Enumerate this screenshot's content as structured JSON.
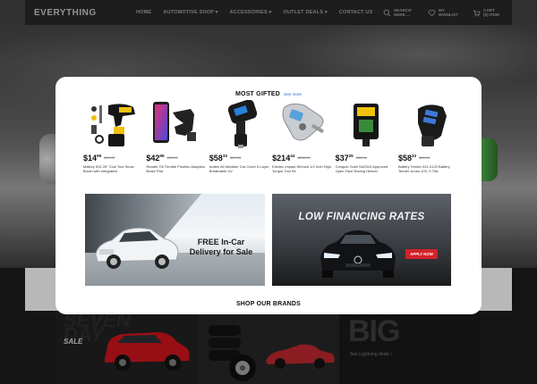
{
  "site": {
    "logo": "EVERYTHING"
  },
  "nav": {
    "links": [
      "HOME",
      "AUTOMOTIVE SHOP ▾",
      "ACCESSORIES ▾",
      "OUTLET DEALS ▾",
      "CONTACT US"
    ],
    "search": {
      "line1": "SEARCH",
      "line2": "HERE ..."
    },
    "wishlist": {
      "line1": "MY",
      "line2": "WISHLIST"
    },
    "cart": {
      "line1": "CART",
      "line2": "(0) ITEM"
    }
  },
  "modal": {
    "title": "MOST GIFTED",
    "see_more": "See more",
    "products": [
      {
        "dollars": "$14",
        "cents": "99",
        "old": "$29.99",
        "name": "Mallory 532 26\" Cool Tool Snow Brush with Integrated",
        "icon": "cordless-tool-kit"
      },
      {
        "dollars": "$42",
        "cents": "99",
        "old": "$84.99",
        "name": "Reader Oil Throttle Position Adaption Brake Pad",
        "icon": "phone-mount"
      },
      {
        "dollars": "$58",
        "cents": "33",
        "old": "$89.99",
        "name": "Autlee All Weather Car Cover 6 Layer Breathable UV",
        "icon": "fm-transmitter"
      },
      {
        "dollars": "$214",
        "cents": "44",
        "old": "$252.99",
        "name": "Electric Impact Wrench 1/2 Inch High Torque Tool Kit",
        "icon": "tire-gauge"
      },
      {
        "dollars": "$37",
        "cents": "25",
        "old": "$56.99",
        "name": "Conquer Snell SA2015 Approved Open Face Racing Helmet",
        "icon": "battery-tender"
      },
      {
        "dollars": "$58",
        "cents": "33",
        "old": "$89.99",
        "name": "Battery Tender 021-0123 Battery Tender Junior 12V, 0.75A",
        "icon": "usb-car-charger"
      }
    ],
    "banner_left": {
      "text_line1": "FREE In-Car",
      "text_line2": "Delivery for Sale"
    },
    "banner_right": {
      "title": "LOW FINANCING RATES",
      "button": "APPLY NOW"
    },
    "brands_title": "SHOP OUR BRANDS"
  },
  "brand_tiles": {
    "tile1": {
      "big_line1": "SEVEN",
      "big_line2": "DAY",
      "sale": "SALE"
    },
    "tile3": {
      "big": "BIG",
      "caption": "See Lightning deals ›"
    }
  },
  "colors": {
    "accent_red": "#d4222a",
    "link_blue": "#2b6cc4",
    "nav_bg": "#262626"
  }
}
